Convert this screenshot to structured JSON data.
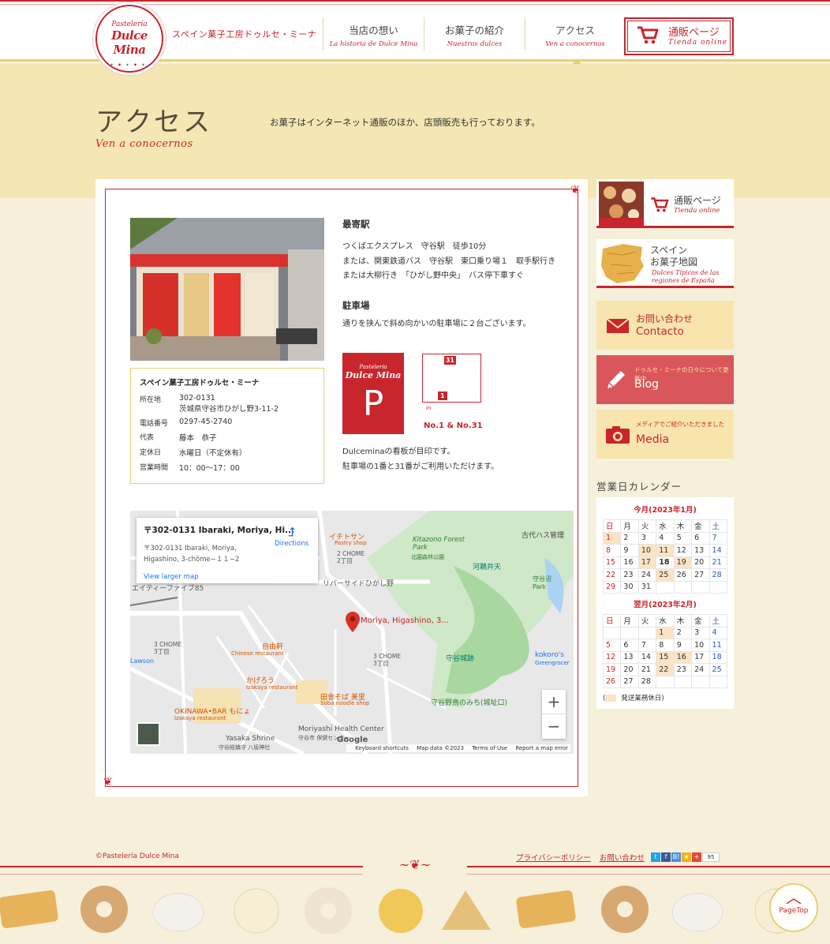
{
  "header": {
    "logo_small": "Pastelería",
    "logo_big": "Dulce Mina",
    "shop_name": "スペイン菓子工房ドゥルセ・ミーナ",
    "nav": [
      {
        "jp": "当店の想い",
        "es": "La historia de Dulce Mina"
      },
      {
        "jp": "お菓子の紹介",
        "es": "Nuestros dulces"
      },
      {
        "jp": "アクセス",
        "es": "Ven a conocernos"
      }
    ],
    "shop_button": {
      "jp": "通販ページ",
      "es": "Tienda online"
    }
  },
  "hero": {
    "title": "アクセス",
    "subtitle": "Ven a conocernos",
    "lead": "お菓子はインターネット通販のほか、店頭販売も行っております。"
  },
  "store": {
    "name": "スペイン菓子工房ドゥルセ・ミーナ",
    "rows": [
      {
        "k": "所在地",
        "v": "302-0131",
        "v2": "茨城県守谷市ひがし野3-11-2"
      },
      {
        "k": "電話番号",
        "v": "0297-45-2740"
      },
      {
        "k": "代表",
        "v": "藤本　恭子"
      },
      {
        "k": "定休日",
        "v": "水曜日（不定休有）"
      },
      {
        "k": "営業時間",
        "v": "10：00〜17：00"
      }
    ]
  },
  "access": {
    "station_title": "最寄駅",
    "station_lines": [
      "つくばエクスプレス　守谷駅　徒歩10分",
      "または、関東鉄道バス　守谷駅　東口乗り場１　取手駅行き",
      "または大柳行き　「ひがし野中央」　バス停下車すぐ"
    ],
    "parking_title": "駐車場",
    "parking_text": "通りを挟んで斜め向かいの駐車場に２台ございます。",
    "parking_sign_small": "Pastelería",
    "parking_sign_big": "Dulce Mina",
    "parking_sign_p": "P",
    "lot_31": "31",
    "lot_1": "1",
    "lot_in": "in",
    "lot_caption": "No.1 & No.31",
    "dulce_lines": [
      "Dulceminaの看板が目印です。",
      "駐車場の1番と31番がご利用いただけます。"
    ]
  },
  "map": {
    "card_title": "〒302-0131 Ibaraki, Moriya, Hi...",
    "card_address1": "〒302-0131 Ibaraki, Moriya,",
    "card_address2": "Higashino, 3-chōme−１１−2",
    "directions": "Directions",
    "larger_map": "View larger map",
    "pin_label": "Moriya, Higashino, 3...",
    "labels": [
      "イチトサン",
      "Pastry shop",
      "Kitazono Forest Park",
      "北園森林公園",
      "古代ハス管理",
      "河鵜弁天",
      "守谷沼 Park",
      "2 CHOME 2丁目",
      "リバーサイドひがし野",
      "エイティーファイブ85",
      "3 CHOME 3丁目",
      "自由軒",
      "Chinese restaurant",
      "3 CHOME 3丁目",
      "守谷城跡",
      "kokoro's",
      "Greengrocer",
      "かげろう",
      "Izakaya restaurant",
      "田舎そば 美里",
      "Soba noodle shop",
      "OKINAWA•BAR もにょ",
      "Izakaya restaurant",
      "守谷野鳥のみち(城址口)",
      "Moriyashi Health Center",
      "守谷市 保健センター",
      "Yasaka Shrine",
      "守谷総鎮守 八坂神社",
      "Lawson"
    ],
    "footer": [
      "Keyboard shortcuts",
      "Map data ©2023",
      "Terms of Use",
      "Report a map error"
    ],
    "google": "Google",
    "zoom_in": "+",
    "zoom_out": "−"
  },
  "sidebar": {
    "shop": {
      "jp": "通販ページ",
      "es": "Tienda online"
    },
    "spain_map": {
      "jp1": "スペイン",
      "jp2": "お菓子地図",
      "es1": "Dulces Típicos de las",
      "es2": "regiones de España"
    },
    "contact": {
      "jp": "お問い合わせ",
      "es": "Contacto"
    },
    "blog": {
      "jp": "ドゥルセ・ミーナの日々について更新中",
      "es": "Blog"
    },
    "media": {
      "jp": "メディアでご紹介いただきました",
      "es": "Media"
    },
    "calendar_title": "営業日カレンダー"
  },
  "calendar": {
    "weekdays": [
      "日",
      "月",
      "火",
      "水",
      "木",
      "金",
      "土"
    ],
    "months": [
      {
        "title": "今月(2023年1月)",
        "weeks": [
          [
            "1",
            "2",
            "3",
            "4",
            "5",
            "6",
            "7"
          ],
          [
            "8",
            "9",
            "10",
            "11",
            "12",
            "13",
            "14"
          ],
          [
            "15",
            "16",
            "17",
            "18",
            "19",
            "20",
            "21"
          ],
          [
            "22",
            "23",
            "24",
            "25",
            "26",
            "27",
            "28"
          ],
          [
            "29",
            "30",
            "31",
            "",
            "",
            "",
            ""
          ]
        ],
        "holidays": [
          "1",
          "10",
          "11",
          "17",
          "19",
          "25"
        ],
        "today": "18"
      },
      {
        "title": "翌月(2023年2月)",
        "weeks": [
          [
            "",
            "",
            "",
            "1",
            "2",
            "3",
            "4"
          ],
          [
            "5",
            "6",
            "7",
            "8",
            "9",
            "10",
            "11"
          ],
          [
            "12",
            "13",
            "14",
            "15",
            "16",
            "17",
            "18"
          ],
          [
            "19",
            "20",
            "21",
            "22",
            "23",
            "24",
            "25"
          ],
          [
            "26",
            "27",
            "28",
            "",
            "",
            "",
            ""
          ]
        ],
        "holidays": [
          "1",
          "15",
          "16",
          "22"
        ],
        "today": ""
      }
    ],
    "legend": "発送業務休日)",
    "legend_open": "("
  },
  "footer": {
    "copyright": "©Pastelería Dulce Mina",
    "privacy": "プライバシーポリシー",
    "contact": "お問い合わせ",
    "share_count": "95",
    "page_top": "PageTop"
  },
  "colors": {
    "accent": "#c8252c",
    "gold": "#e8cf73",
    "cream": "#f5e7b3"
  }
}
